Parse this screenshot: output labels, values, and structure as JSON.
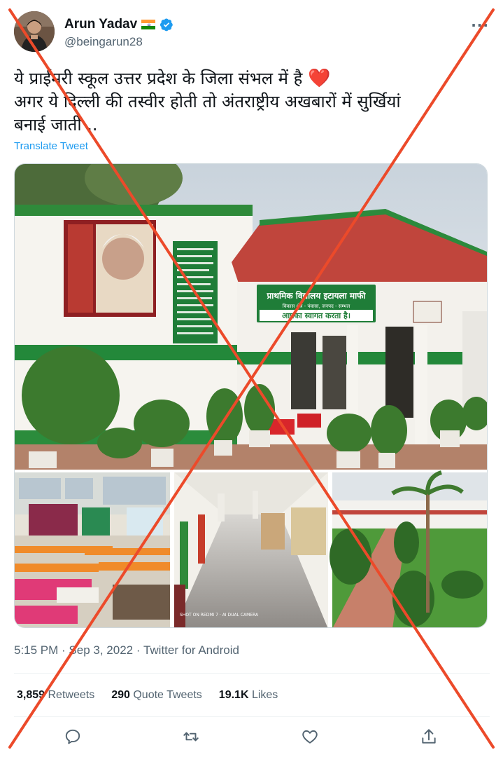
{
  "user": {
    "display_name": "Arun Yadav",
    "handle": "@beingarun28",
    "flag_colors": [
      "#ff9933",
      "#ffffff",
      "#138808"
    ],
    "verified_color": "#1d9bf0"
  },
  "more_icon": "more-horizontal-icon",
  "tweet": {
    "lines": [
      "ये प्राईमरी स्कूल उत्तर प्रदेश के जिला संभल में है",
      "अगर ये दिल्ली की तस्वीर होती तो अंतराष्ट्रीय अखबारों में सुर्खियां",
      "बनाई जाती .."
    ],
    "heart": "❤️",
    "translate_label": "Translate Tweet"
  },
  "media": {
    "signboard_line1": "प्राथमिक विद्यालय इटायला माफी",
    "signboard_line2": "विकास क्षेत्र - पंवासा, जनपद - सम्भल",
    "signboard_line3": "आपका स्वागत करता है।",
    "watermark": "SHOT ON REDMI 7 · AI DUAL CAMERA"
  },
  "meta": {
    "time": "5:15 PM",
    "date": "Sep 3, 2022",
    "source": "Twitter for Android",
    "separator": " · "
  },
  "stats": {
    "retweets_count": "3,859",
    "retweets_label": "Retweets",
    "quotes_count": "290",
    "quotes_label": "Quote Tweets",
    "likes_count": "19.1K",
    "likes_label": "Likes"
  },
  "actions": {
    "icons": [
      "reply-icon",
      "retweet-icon",
      "like-icon",
      "share-icon"
    ]
  },
  "colors": {
    "accent": "#1d9bf0",
    "secondary_text": "#536471",
    "cross_mark": "#ec4a2a"
  }
}
